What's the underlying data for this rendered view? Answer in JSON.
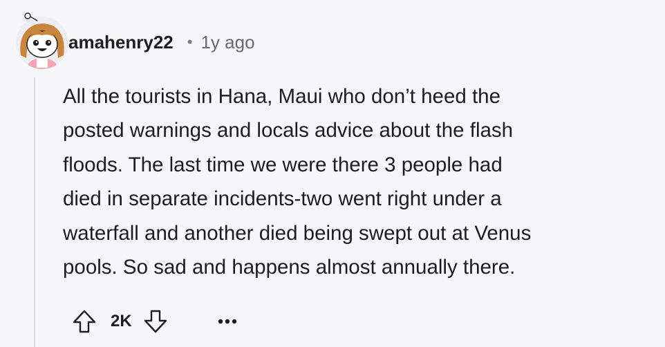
{
  "comment": {
    "username": "amahenry22",
    "separator": "•",
    "time_ago": "1y ago",
    "body_lines": [
      "All the tourists in Hana, Maui who don’t heed the",
      "posted warnings and locals advice about the flash",
      "floods. The last time we were there 3 people had",
      "died in separate incidents-two went right under a",
      "waterfall and another died being swept out at Venus",
      "pools. So sad and happens almost annually there."
    ],
    "score": "2K"
  },
  "icons": {
    "avatar": "snoo-avatar-icon",
    "upvote": "arrow-up-icon",
    "downvote": "arrow-down-icon",
    "more": "ellipsis-icon"
  },
  "colors": {
    "background": "#f6f7f9",
    "text": "#1c1c1c",
    "muted": "#6a6a6a",
    "thread_line": "#d9dadc"
  }
}
